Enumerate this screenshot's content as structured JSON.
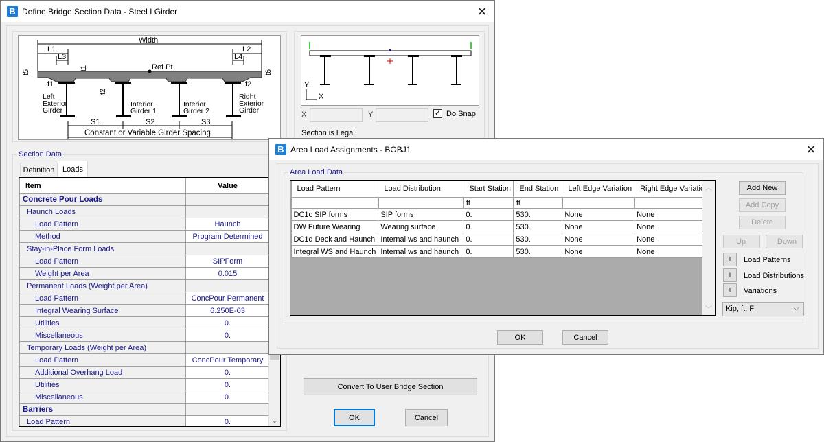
{
  "bridge_dialog": {
    "title": "Define Bridge Section Data - Steel I Girder",
    "app_icon": "B",
    "schematic": {
      "labels": [
        "Width",
        "L1",
        "L2",
        "L3",
        "L4",
        "t5",
        "t6",
        "t1",
        "t2",
        "f1",
        "f2",
        "Ref Pt",
        "Left Exterior Girder",
        "Interior Girder 1",
        "Interior Girder 2",
        "Right Exterior Girder",
        "S1",
        "S2",
        "S3",
        "Constant or Variable Girder Spacing"
      ]
    },
    "preview": {
      "axis_y": "Y",
      "axis_x": "X",
      "x_label": "X",
      "y_label": "Y",
      "x_value": "",
      "y_value": "",
      "do_snap_label": "Do Snap",
      "do_snap_checked": true,
      "status": "Section is Legal"
    },
    "section_data_label": "Section Data",
    "tabs": [
      {
        "label": "Definition",
        "active": false
      },
      {
        "label": "Loads",
        "active": true
      }
    ],
    "grid": {
      "headers": [
        "Item",
        "Value"
      ],
      "rows": [
        {
          "item": "Concrete Pour Loads",
          "value": "",
          "level": 0
        },
        {
          "item": "Haunch Loads",
          "value": "",
          "level": 1
        },
        {
          "item": "Load Pattern",
          "value": "Haunch",
          "level": 2
        },
        {
          "item": "Method",
          "value": "Program Determined",
          "level": 2
        },
        {
          "item": "Stay-in-Place Form Loads",
          "value": "",
          "level": 1
        },
        {
          "item": "Load Pattern",
          "value": "SIPForm",
          "level": 2
        },
        {
          "item": "Weight per Area",
          "value": "0.015",
          "level": 2
        },
        {
          "item": "Permanent Loads (Weight per Area)",
          "value": "",
          "level": 1
        },
        {
          "item": "Load Pattern",
          "value": "ConcPour Permanent",
          "level": 2
        },
        {
          "item": "Integral Wearing Surface",
          "value": "6.250E-03",
          "level": 2
        },
        {
          "item": "Utilities",
          "value": "0.",
          "level": 2
        },
        {
          "item": "Miscellaneous",
          "value": "0.",
          "level": 2
        },
        {
          "item": "Temporary Loads (Weight per Area)",
          "value": "",
          "level": 1
        },
        {
          "item": "Load Pattern",
          "value": "ConcPour Temporary",
          "level": 2
        },
        {
          "item": "Additional Overhang Load",
          "value": "0.",
          "level": 2
        },
        {
          "item": "Utilities",
          "value": "0.",
          "level": 2
        },
        {
          "item": "Miscellaneous",
          "value": "0.",
          "level": 2
        },
        {
          "item": "Barriers",
          "value": "",
          "level": 0
        },
        {
          "item": "Load Pattern",
          "value": "0.",
          "level": 1
        }
      ]
    },
    "convert_button": "Convert To User Bridge Section",
    "ok_button": "OK",
    "cancel_button": "Cancel"
  },
  "area_dialog": {
    "title": "Area Load Assignments - BOBJ1",
    "app_icon": "B",
    "group_label": "Area Load Data",
    "columns": [
      "Load Pattern",
      "Load Distribution",
      "Start Station",
      "End Station",
      "Left Edge Variation",
      "Right Edge Variation"
    ],
    "units": [
      "",
      "",
      "ft",
      "ft",
      "",
      ""
    ],
    "rows": [
      [
        "DC1c SIP forms",
        "SIP forms",
        "0.",
        "530.",
        "None",
        "None"
      ],
      [
        "DW Future Wearing",
        "Wearing surface",
        "0.",
        "530.",
        "None",
        "None"
      ],
      [
        "DC1d Deck and Haunch",
        "Internal ws and haunch",
        "0.",
        "530.",
        "None",
        "None"
      ],
      [
        "Integral WS and Haunch",
        "Internal ws and haunch",
        "0.",
        "530.",
        "None",
        "None"
      ]
    ],
    "buttons": {
      "add_new": "Add New",
      "add_copy": "Add Copy",
      "delete": "Delete",
      "up": "Up",
      "down": "Down"
    },
    "expanders": [
      "Load Patterns",
      "Load Distributions",
      "Variations"
    ],
    "units_select": "Kip, ft, F",
    "ok_button": "OK",
    "cancel_button": "Cancel"
  },
  "colors": {
    "accent": "#0078d7",
    "label_blue": "#1a1a8c",
    "guide_green": "#00c000",
    "centroid_red": "#e00000"
  }
}
